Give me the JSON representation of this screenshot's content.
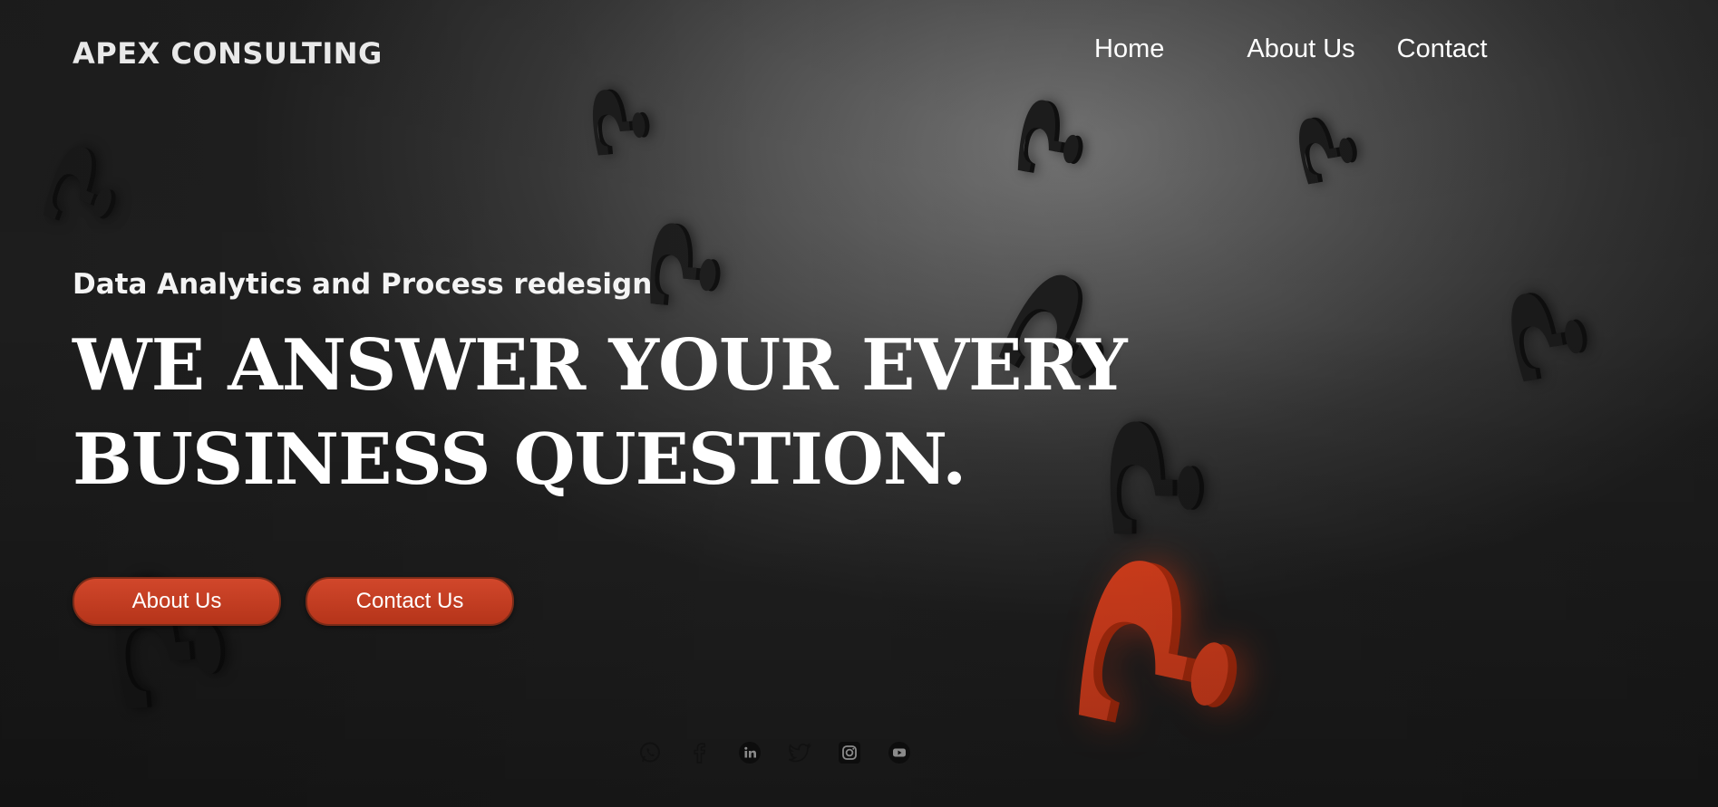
{
  "brand": {
    "name": "APEX CONSULTING"
  },
  "nav": {
    "items": [
      {
        "label": "Home"
      },
      {
        "label": "About Us"
      },
      {
        "label": "Contact"
      }
    ]
  },
  "hero": {
    "subtitle": "Data Analytics and Process redesign",
    "headline_line1": "WE ANSWER YOUR EVERY",
    "headline_line2": "BUSINESS QUESTION.",
    "buttons": {
      "about": "About Us",
      "contact": "Contact Us"
    },
    "accent_color": "#c23d20",
    "highlight_color": "#ff4a22"
  },
  "social": {
    "icons": [
      "whatsapp-icon",
      "facebook-icon",
      "linkedin-icon",
      "twitter-icon",
      "instagram-icon",
      "youtube-icon"
    ]
  }
}
